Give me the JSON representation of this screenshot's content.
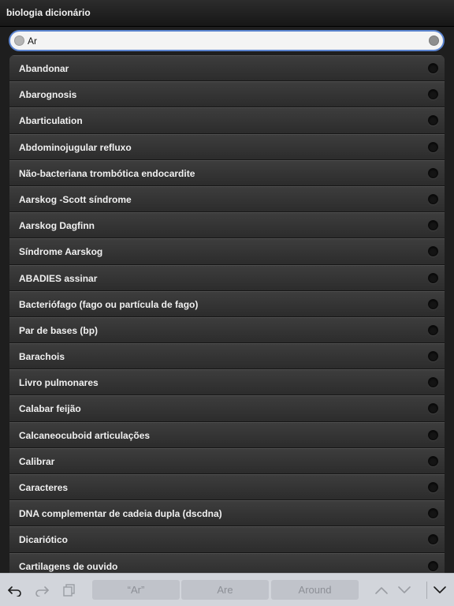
{
  "app": {
    "title": "biologia dicionário"
  },
  "search": {
    "value": "Ar",
    "placeholder": ""
  },
  "terms": [
    "Abandonar",
    "Abarognosis",
    "Abarticulation",
    "Abdominojugular refluxo",
    "Não-bacteriana trombótica endocardite",
    "Aarskog -Scott síndrome",
    "Aarskog Dagfinn",
    "Síndrome Aarskog",
    "ABADIES assinar",
    "Bacteriófago (fago ou partícula de fago)",
    "Par de bases (bp)",
    "Barachois",
    "Livro pulmonares",
    "Calabar feijão",
    "Calcaneocuboid articulações",
    "Calibrar",
    "Caracteres",
    "DNA complementar de cadeia dupla (dscdna)",
    "Dicariótico",
    "Cartilagens de ouvido"
  ],
  "keyboard": {
    "suggestions": [
      "“Ar”",
      "Are",
      "Around"
    ],
    "icons": {
      "undo": "undo-icon",
      "redo": "redo-icon",
      "paste": "paste-icon",
      "up": "chevron-up-icon",
      "down": "chevron-down-icon",
      "dismiss": "dismiss-keyboard-icon"
    }
  },
  "colors": {
    "accent": "#5b84d0",
    "row": "#333333",
    "text": "#f0f0f0"
  }
}
